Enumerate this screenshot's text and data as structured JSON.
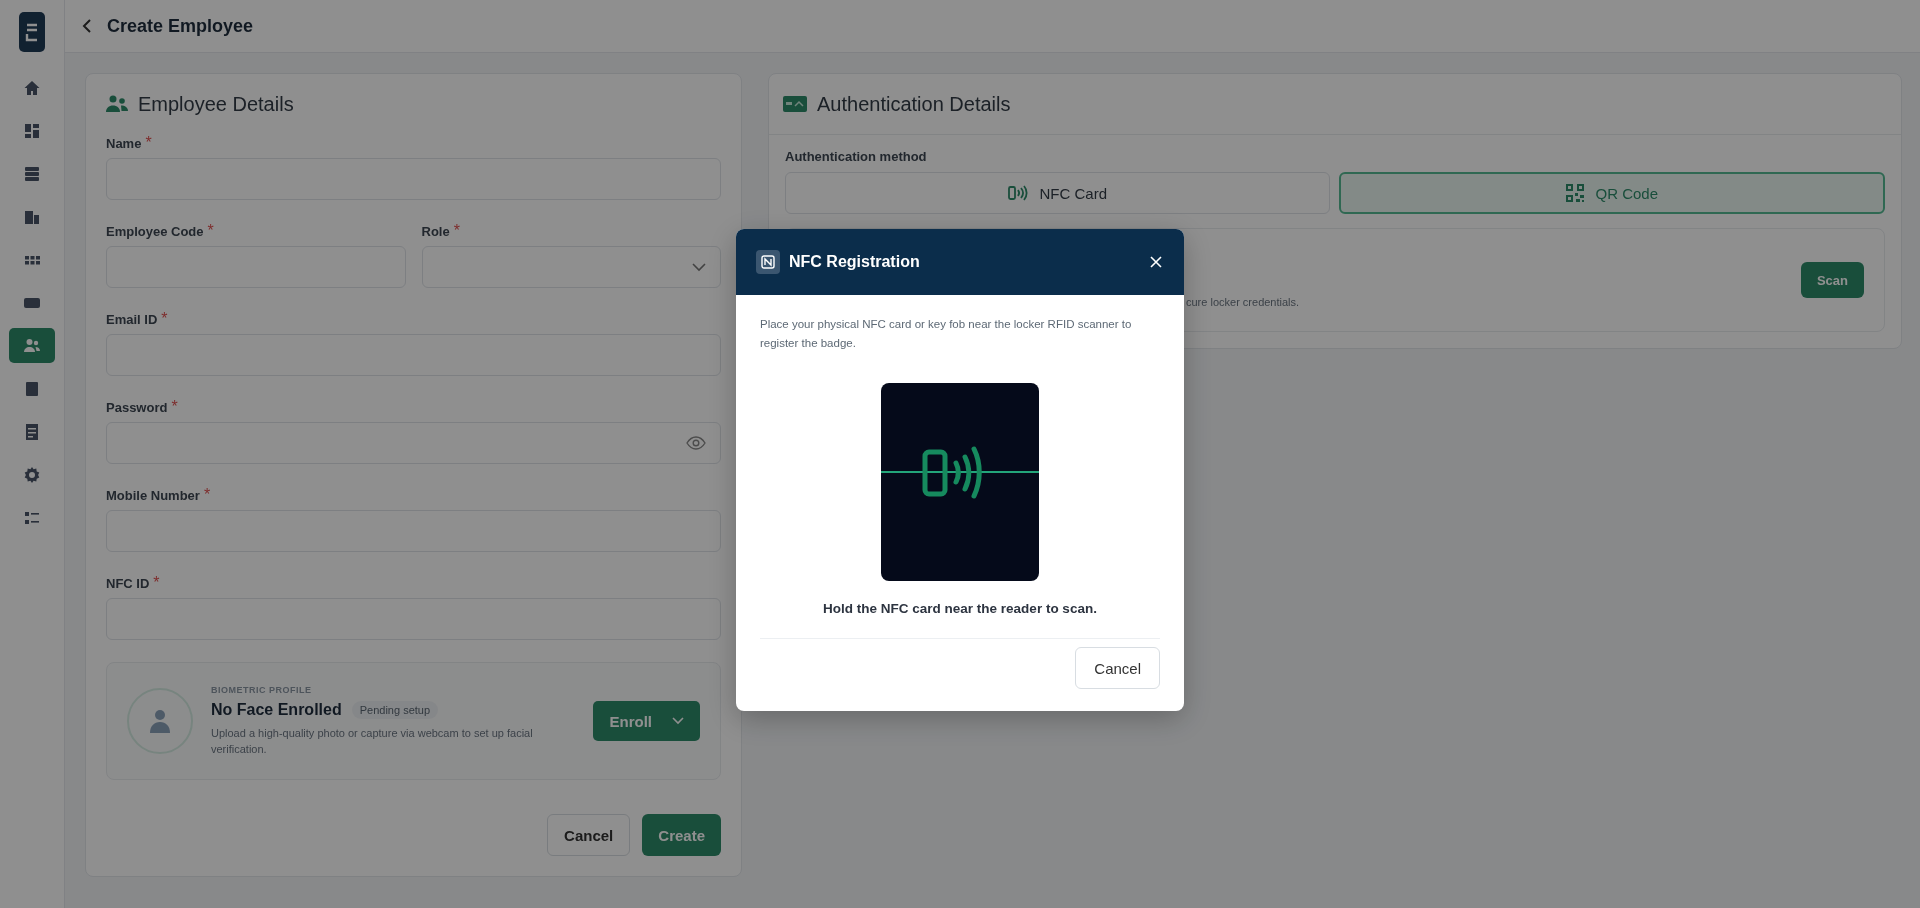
{
  "sidebar": {
    "items": [
      {
        "kind": "home",
        "selected": false
      },
      {
        "kind": "dashboard",
        "selected": false
      },
      {
        "kind": "server",
        "selected": false
      },
      {
        "kind": "buildings",
        "selected": false
      },
      {
        "kind": "apps",
        "selected": false
      },
      {
        "kind": "card",
        "selected": false
      },
      {
        "kind": "users",
        "selected": true
      },
      {
        "kind": "table",
        "selected": false
      },
      {
        "kind": "document",
        "selected": false
      },
      {
        "kind": "settings",
        "selected": false
      },
      {
        "kind": "checklist",
        "selected": false
      }
    ]
  },
  "header": {
    "title": "Create Employee"
  },
  "employee_details": {
    "title": "Employee Details",
    "field_rows": [
      {
        "fields": [
          {
            "label": "Name",
            "required_mark": "*",
            "kind": "text"
          }
        ]
      },
      {
        "fields": [
          {
            "label": "Employee Code",
            "required_mark": "*",
            "kind": "text"
          },
          {
            "label": "Role",
            "required_mark": "*",
            "kind": "select"
          }
        ]
      },
      {
        "fields": [
          {
            "label": "Email ID",
            "required_mark": "*",
            "kind": "text"
          }
        ]
      },
      {
        "fields": [
          {
            "label": "Password",
            "required_mark": "*",
            "kind": "password"
          }
        ]
      },
      {
        "fields": [
          {
            "label": "Mobile Number",
            "required_mark": "*",
            "kind": "text"
          }
        ]
      },
      {
        "fields": [
          {
            "label": "NFC ID",
            "required_mark": "*",
            "kind": "text"
          }
        ]
      }
    ],
    "biometric": {
      "eyebrow": "BIOMETRIC PROFILE",
      "title": "No Face Enrolled",
      "badge": "Pending setup",
      "description": "Upload a high-quality photo or capture via webcam to set up facial verification.",
      "button": "Enroll"
    },
    "buttons": {
      "cancel": "Cancel",
      "create": "Create"
    }
  },
  "authentication_details": {
    "title": "Authentication Details",
    "method_label": "Authentication method",
    "methods": [
      {
        "label": "NFC Card",
        "kind": "nfc",
        "selected": false
      },
      {
        "label": "QR Code",
        "kind": "qr",
        "selected": true
      }
    ],
    "scan_card": {
      "description": "cure locker credentials.",
      "button": "Scan"
    }
  },
  "modal": {
    "title": "NFC Registration",
    "description": "Place your physical NFC card or key fob near the locker RFID scanner to register the badge.",
    "caption": "Hold the NFC card near the reader to scan.",
    "button": "Cancel"
  }
}
